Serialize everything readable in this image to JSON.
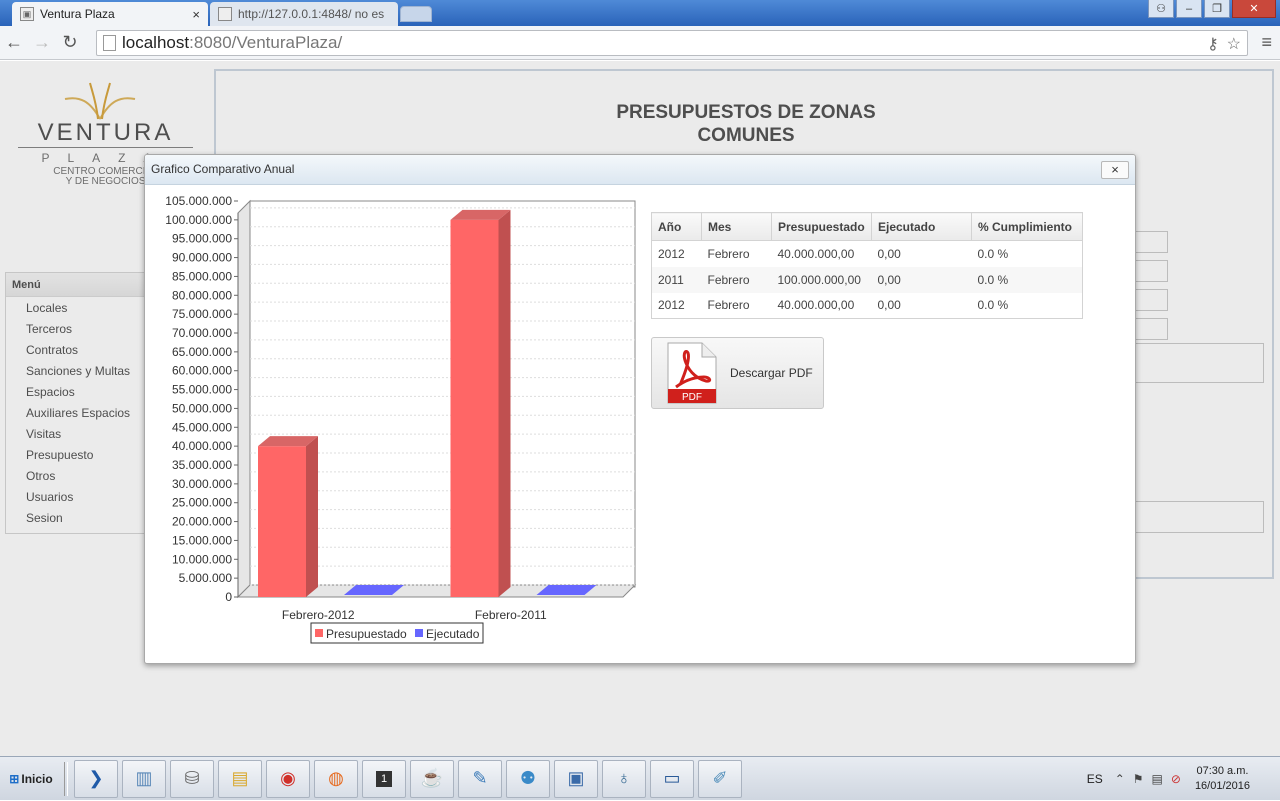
{
  "browser": {
    "tabs": [
      {
        "label": "Ventura Plaza",
        "active": true
      },
      {
        "label": "http://127.0.0.1:4848/ no es",
        "active": false
      }
    ],
    "url_host": "localhost",
    "url_rest": ":8080/VenturaPlaza/"
  },
  "logo": {
    "word": "VENTURA",
    "sub": "PLAZA",
    "tag_line1": "CENTRO COMERCIAL",
    "tag_line2": "Y DE NEGOCIOS"
  },
  "sidebar": {
    "header": "Menú",
    "items": [
      {
        "label": "Locales"
      },
      {
        "label": "Terceros"
      },
      {
        "label": "Contratos"
      },
      {
        "label": "Sanciones y Multas"
      },
      {
        "label": "Espacios"
      },
      {
        "label": "Auxiliares Espacios"
      },
      {
        "label": "Visitas"
      },
      {
        "label": "Presupuesto"
      },
      {
        "label": "Otros"
      },
      {
        "label": "Usuarios"
      },
      {
        "label": "Sesion"
      }
    ]
  },
  "content": {
    "title_line1": "PRESUPUESTOS DE ZONAS",
    "title_line2": "COMUNES"
  },
  "dialog": {
    "title": "Grafico Comparativo Anual",
    "close_glyph": "×",
    "table": {
      "headers": [
        "Año",
        "Mes",
        "Presupuestado",
        "Ejecutado",
        "% Cumplimiento"
      ],
      "rows": [
        [
          "2012",
          "Febrero",
          "40.000.000,00",
          "0,00",
          "0.0 %"
        ],
        [
          "2011",
          "Febrero",
          "100.000.000,00",
          "0,00",
          "0.0 %"
        ],
        [
          "2012",
          "Febrero",
          "40.000.000,00",
          "0,00",
          "0.0 %"
        ]
      ]
    },
    "pdf_button_label": "Descargar PDF",
    "pdf_icon_text": "PDF"
  },
  "chart_data": {
    "type": "bar",
    "categories": [
      "Febrero-2012",
      "Febrero-2011"
    ],
    "series": [
      {
        "name": "Presupuestado",
        "values": [
          40000000,
          100000000
        ],
        "color": "#ff6666"
      },
      {
        "name": "Ejecutado",
        "values": [
          0,
          0
        ],
        "color": "#6666ff"
      }
    ],
    "ylim": [
      0,
      105000000
    ],
    "ytick_step": 5000000,
    "ytick_labels": [
      "0",
      "5.000.000",
      "10.000.000",
      "15.000.000",
      "20.000.000",
      "25.000.000",
      "30.000.000",
      "35.000.000",
      "40.000.000",
      "45.000.000",
      "50.000.000",
      "55.000.000",
      "60.000.000",
      "65.000.000",
      "70.000.000",
      "75.000.000",
      "80.000.000",
      "85.000.000",
      "90.000.000",
      "95.000.000",
      "100.000.000",
      "105.000.000"
    ],
    "grid": true,
    "legend_position": "bottom",
    "style": "3d"
  },
  "taskbar": {
    "start_label": "Inicio",
    "items": [
      "powershell-icon",
      "server-manager-icon",
      "network-icon",
      "folder-icon",
      "chrome-icon",
      "firefox-icon",
      "terminal-icon",
      "java-icon",
      "editor-icon",
      "directory-icon",
      "remote-desktop-icon",
      "postgres-icon",
      "computer-icon",
      "notepad-icon"
    ],
    "terminal_badge": "1",
    "lang": "ES",
    "time": "07:30 a.m.",
    "date": "16/01/2016"
  }
}
